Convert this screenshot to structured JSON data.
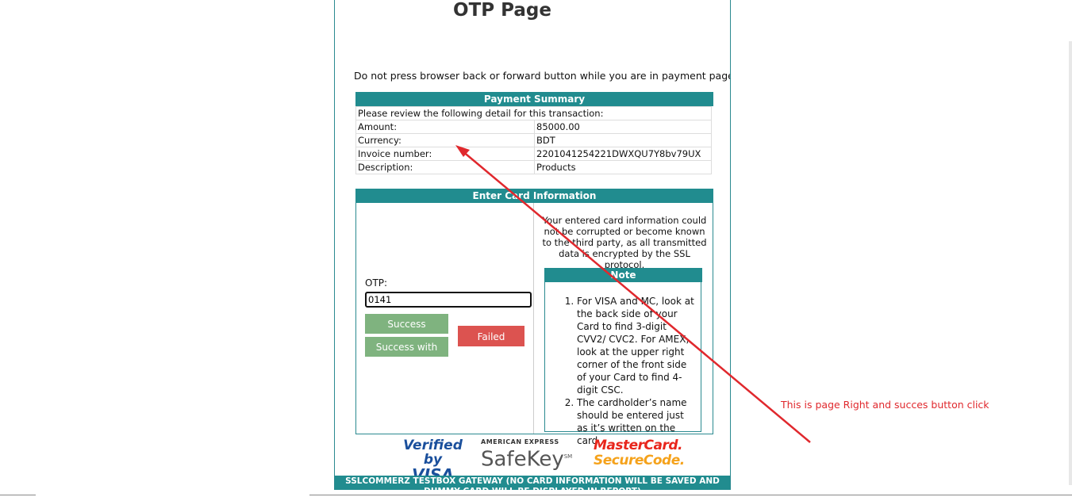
{
  "page": {
    "title": "OTP Page",
    "warning": "Do not press browser back or forward button while you are in payment page"
  },
  "summary": {
    "header": "Payment Summary",
    "intro": "Please review the following detail for this transaction:",
    "rows": [
      {
        "label": "Amount:",
        "value": "85000.00"
      },
      {
        "label": "Currency:",
        "value": "BDT"
      },
      {
        "label": "Invoice number:",
        "value": "2201041254221DWXQU7Y8bv79UX"
      },
      {
        "label": "Description:",
        "value": "Products"
      }
    ]
  },
  "card": {
    "header": "Enter Card Information",
    "otp_label": "OTP:",
    "otp_value": "0141",
    "success_label": "Success",
    "risk_label": "Success with risk",
    "failed_label": "Failed",
    "secure_text": "Your entered card information could not be corrupted or become known to the third party, as all transmitted data is encrypted by the SSL protocol.",
    "note": {
      "header": "Note",
      "items": [
        "For VISA and MC, look at the back side of your Card to find 3-digit CVV2/ CVC2. For AMEX, look at the upper right corner of the front side of your Card to find 4-digit CSC.",
        "The cardholder’s name should be entered just as it’s written on the card."
      ]
    }
  },
  "logos": {
    "visa_line1": "Verified by",
    "visa_line2": "VISA",
    "amex_line1": "AMERICAN EXPRESS",
    "amex_line2": "SafeKey",
    "amex_tm": "SM",
    "mc_line1": "MasterCard.",
    "mc_line2": "SecureCode."
  },
  "footer": "SSLCOMMERZ TESTBOX GATEWAY (NO CARD INFORMATION WILL BE SAVED AND DUMMY CARD WILL BE DISPLAYED IN REPORT)",
  "annotation": {
    "text": "This is page Right and succes button click",
    "color": "#e0282d"
  },
  "colors": {
    "teal": "#218c8f",
    "success": "#7fb37f",
    "failed": "#dc5350"
  }
}
